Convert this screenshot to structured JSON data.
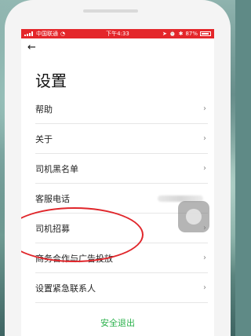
{
  "status_bar": {
    "carrier": "中国联通",
    "time": "下午4:33",
    "battery": "87%"
  },
  "header": {
    "back_icon": "arrow-left-icon",
    "title": "设置"
  },
  "menu": {
    "items": [
      {
        "label": "帮助"
      },
      {
        "label": "关于"
      },
      {
        "label": "司机黑名单"
      },
      {
        "label": "客服电话"
      },
      {
        "label": "司机招募"
      },
      {
        "label": "商务合作与广告投放"
      },
      {
        "label": "设置紧急联系人"
      }
    ],
    "chevron": "›"
  },
  "logout": {
    "label": "安全退出"
  },
  "colors": {
    "status_bar": "#e4262a",
    "logout_text": "#2bb24c",
    "highlight_ellipse": "#e0262b"
  }
}
